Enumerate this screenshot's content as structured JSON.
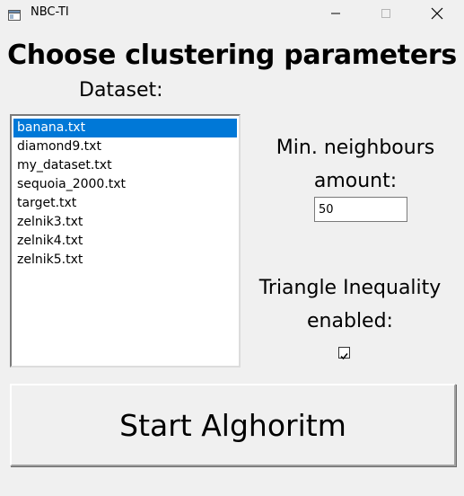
{
  "window": {
    "title": "NBC-TI",
    "icon": "app-window-icon",
    "controls": [
      "minimize",
      "maximize",
      "close"
    ]
  },
  "heading": "Choose clustering parameters",
  "dataset": {
    "label": "Dataset:",
    "items": [
      "banana.txt",
      "diamond9.txt",
      "my_dataset.txt",
      "sequoia_2000.txt",
      "target.txt",
      "zelnik3.txt",
      "zelnik4.txt",
      "zelnik5.txt"
    ],
    "selected": "banana.txt"
  },
  "min_neighbours": {
    "label_line1": "Min. neighbours",
    "label_line2": "amount:",
    "value": "50"
  },
  "triangle_inequality": {
    "label_line1": "Triangle Inequality",
    "label_line2": "enabled:",
    "checked": true
  },
  "start_button": {
    "label": "Start Alghoritm"
  },
  "colors": {
    "background": "#f0f0f0",
    "selection": "#0078d7"
  }
}
